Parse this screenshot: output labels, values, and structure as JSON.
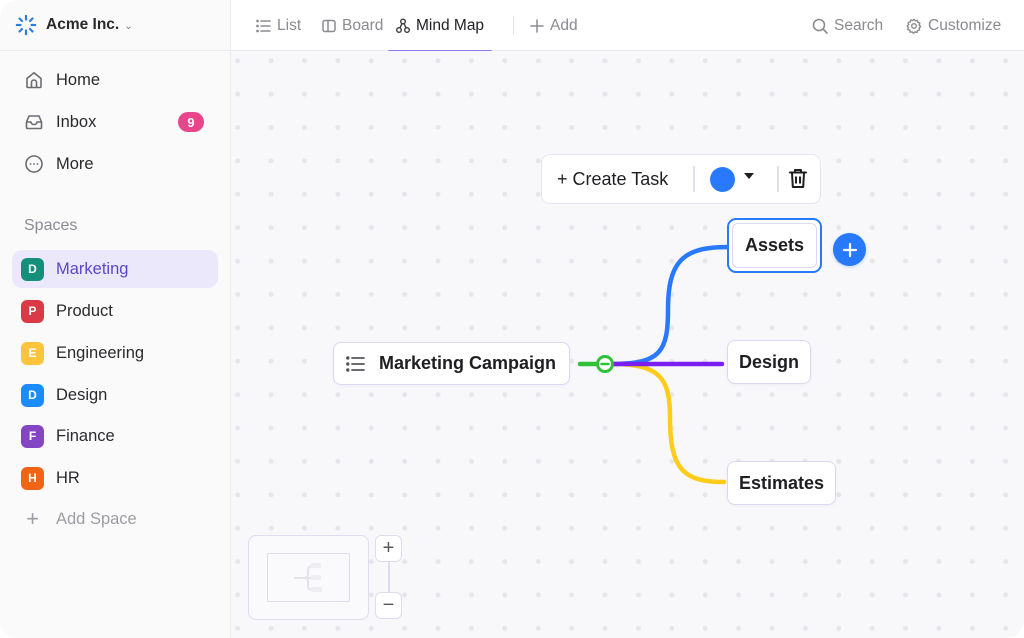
{
  "workspace": {
    "name": "Acme Inc.",
    "logo_icon": "spinner-burst-icon",
    "chevron_icon": "chevron-down-icon"
  },
  "nav": [
    {
      "label": "Home",
      "icon": "home-icon"
    },
    {
      "label": "Inbox",
      "icon": "inbox-icon",
      "badge": "9"
    },
    {
      "label": "More",
      "icon": "more-circle-icon"
    }
  ],
  "spaces": {
    "header": "Spaces",
    "items": [
      {
        "initial": "D",
        "label": "Marketing",
        "color": "#138f7a",
        "active": true
      },
      {
        "initial": "P",
        "label": "Product",
        "color": "#d93a45"
      },
      {
        "initial": "E",
        "label": "Engineering",
        "color": "#fbc43c"
      },
      {
        "initial": "D",
        "label": "Design",
        "color": "#1a8cff"
      },
      {
        "initial": "F",
        "label": "Finance",
        "color": "#8445c4"
      },
      {
        "initial": "H",
        "label": "HR",
        "color": "#f06413"
      }
    ],
    "add_label": "Add Space"
  },
  "topbar": {
    "tabs": [
      {
        "label": "List",
        "icon": "list-icon"
      },
      {
        "label": "Board",
        "icon": "board-icon"
      },
      {
        "label": "Mind Map",
        "icon": "mind-map-icon",
        "active": true
      }
    ],
    "add_label": "Add",
    "search_label": "Search",
    "customize_label": "Customize"
  },
  "mindmap": {
    "toolbar": {
      "create_task_label": "+ Create Task",
      "selected_color": "#2979ff"
    },
    "root": {
      "label": "Marketing Campaign"
    },
    "children": [
      {
        "label": "Assets",
        "branch_color": "#2979ff",
        "selected": true
      },
      {
        "label": "Design",
        "branch_color": "#7b1ff0"
      },
      {
        "label": "Estimates",
        "branch_color": "#ffcc19"
      }
    ],
    "root_connector_color": "#2fc236"
  },
  "zoom_controls": {
    "zoom_in": "+",
    "zoom_out": "−"
  }
}
